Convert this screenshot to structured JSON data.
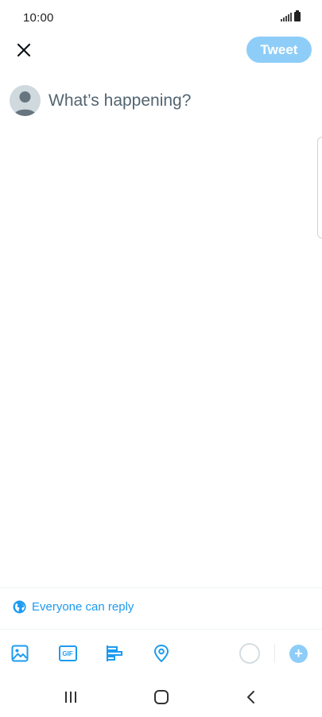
{
  "status_bar": {
    "time": "10:00"
  },
  "header": {
    "close_icon": "close-icon",
    "tweet_label": "Tweet",
    "tweet_color": "#8ecdf8"
  },
  "composer": {
    "placeholder": "What’s happening?",
    "value": ""
  },
  "reply_setting": {
    "icon": "globe-icon",
    "label": "Everyone can reply"
  },
  "toolbar": {
    "items": [
      "image-icon",
      "gif-icon",
      "poll-icon",
      "location-icon"
    ],
    "gif_text": "GIF",
    "add_symbol": "+"
  },
  "nav": {
    "items": [
      "recent-apps-icon",
      "home-icon",
      "back-icon"
    ]
  },
  "colors": {
    "accent": "#1d9bf0",
    "placeholder": "#536471"
  }
}
